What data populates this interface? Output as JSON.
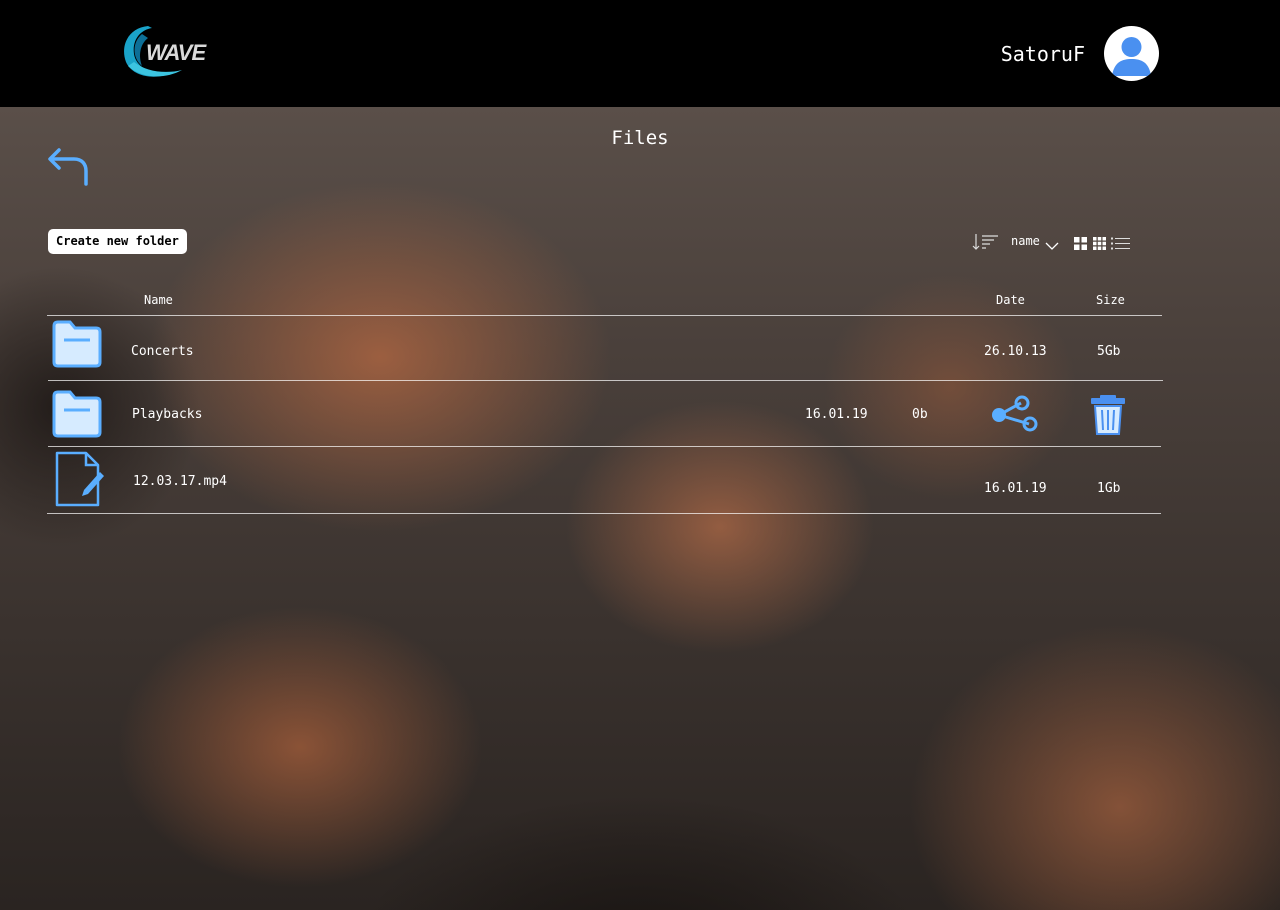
{
  "header": {
    "logo_text": "WAVE",
    "username": "SatoruF"
  },
  "page": {
    "title": "Files"
  },
  "toolbar": {
    "create_folder_label": "Create new folder",
    "sort_field": "name"
  },
  "table": {
    "columns": {
      "name": "Name",
      "date": "Date",
      "size": "Size"
    },
    "rows": [
      {
        "type": "folder",
        "name": "Concerts",
        "date": "26.10.13",
        "size": "5Gb"
      },
      {
        "type": "folder",
        "name": "Playbacks",
        "date": "16.01.19",
        "size": "0b"
      },
      {
        "type": "file",
        "name": "12.03.17.mp4",
        "date": "16.01.19",
        "size": "1Gb"
      }
    ]
  },
  "colors": {
    "accent": "#5aaeff",
    "header_bg": "#000000",
    "avatar_blue": "#4a90f0"
  },
  "icons": [
    "wave-logo",
    "user-avatar-icon",
    "back-arrow-icon",
    "sort-icon",
    "chevron-down-icon",
    "grid-large-icon",
    "grid-small-icon",
    "list-view-icon",
    "folder-icon",
    "file-edit-icon",
    "share-icon",
    "trash-icon"
  ]
}
